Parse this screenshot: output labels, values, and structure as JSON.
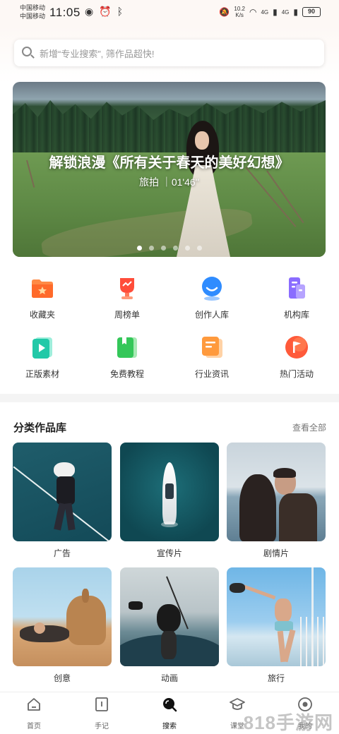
{
  "status_bar": {
    "carrier_1": "中国移动",
    "carrier_2": "中国移动",
    "time": "11:05",
    "net_speed_value": "10.2",
    "net_speed_unit": "K/s",
    "network_1": "4G",
    "network_2": "4G",
    "battery": "90"
  },
  "search": {
    "placeholder": "新增“专业搜索”, 筛作品超快!"
  },
  "banner": {
    "title": "解锁浪漫《所有关于春天的美好幻想》",
    "subtitle": "旅拍 ｜01'46''",
    "slide_count": 6,
    "active_slide": 1
  },
  "quick_links": [
    {
      "label": "收藏夹",
      "icon": "folder-star-icon",
      "color": "#ff7a3d"
    },
    {
      "label": "周榜单",
      "icon": "trophy-icon",
      "color": "#ff4d3a"
    },
    {
      "label": "创作人库",
      "icon": "creator-person-icon",
      "color": "#2f8cff"
    },
    {
      "label": "机构库",
      "icon": "building-icon",
      "color": "#8a6cff"
    },
    {
      "label": "正版素材",
      "icon": "play-file-icon",
      "color": "#22c9a8"
    },
    {
      "label": "免费教程",
      "icon": "book-icon",
      "color": "#34c759"
    },
    {
      "label": "行业资讯",
      "icon": "news-icon",
      "color": "#ff9a3d"
    },
    {
      "label": "热门活动",
      "icon": "flag-icon",
      "color": "#ff5a3a"
    }
  ],
  "category_section": {
    "title": "分类作品库",
    "more_label": "查看全部",
    "items": [
      {
        "label": "广告"
      },
      {
        "label": "宣传片"
      },
      {
        "label": "剧情片"
      },
      {
        "label": "创意"
      },
      {
        "label": "动画"
      },
      {
        "label": "旅行"
      }
    ]
  },
  "tabbar": {
    "items": [
      {
        "label": "首页",
        "icon": "home-icon"
      },
      {
        "label": "手记",
        "icon": "notebook-icon"
      },
      {
        "label": "搜索",
        "icon": "search-icon",
        "active": true
      },
      {
        "label": "课堂",
        "icon": "graduation-cap-icon"
      },
      {
        "label": "我的",
        "icon": "profile-icon"
      }
    ]
  },
  "watermark": "818手游网"
}
